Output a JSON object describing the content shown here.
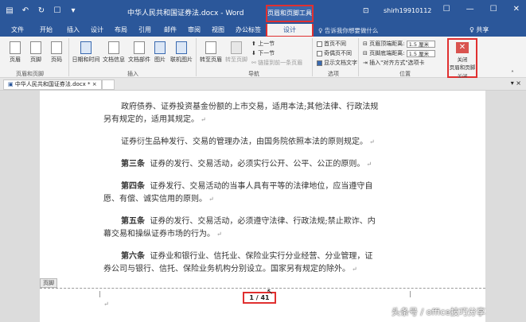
{
  "titlebar": {
    "quick_access": [
      "save-icon",
      "undo-icon",
      "redo-icon",
      "touch-icon",
      "customize-icon"
    ],
    "quick_access_glyphs": [
      "▤",
      "↶",
      "↻",
      "☐",
      "▾"
    ],
    "doc_title": "中华人民共和国证券法.docx - Word",
    "contextual_tool": "页眉和页脚工具",
    "account": "shirh19910112",
    "window_buttons": [
      "☐",
      "—",
      "☐",
      "✕"
    ]
  },
  "tabs": {
    "items": [
      "文件",
      "开始",
      "插入",
      "设计",
      "布局",
      "引用",
      "邮件",
      "审阅",
      "视图",
      "办公标签"
    ],
    "active": "设计",
    "tellme": "♀ 告诉我你想要做什么",
    "share": "♀ 共享"
  },
  "ribbon": {
    "header_footer": {
      "items": [
        "页眉",
        "页脚",
        "页码"
      ],
      "group": "页眉和页脚"
    },
    "insert": {
      "items": [
        "日期和时间",
        "文档信息",
        "文档部件",
        "图片",
        "联机图片"
      ],
      "group": "插入"
    },
    "nav": {
      "goto_header": "转至页眉",
      "goto_footer": "转至页脚",
      "prev": "上一节",
      "next": "下一节",
      "link": "链接到前一条页眉",
      "group": "导航"
    },
    "options": {
      "items": [
        "首页不同",
        "奇偶页不同",
        "显示文档文字"
      ],
      "checked": [
        false,
        false,
        true
      ],
      "group": "选项"
    },
    "position": {
      "header_dist_label": "页眉顶端距离:",
      "header_dist_value": "1.5 厘米",
      "footer_dist_label": "页脚底端距离:",
      "footer_dist_value": "1.5 厘米",
      "insert_align": "插入\"对齐方式\"选项卡",
      "group": "位置"
    },
    "close": {
      "line1": "关闭",
      "line2": "页眉和页脚",
      "group": "关闭"
    }
  },
  "doctabs": {
    "active": "中华人民共和国证券法.docx *",
    "close_glyph": "×",
    "right_glyph": "▾"
  },
  "document": {
    "lines": [
      "政府债券、证券投资基金份额的上市交易，适用本法;其他法律、行政法规",
      "另有规定的，适用其规定。",
      "证券衍生品种发行、交易的管理办法，由国务院依照本法的原则规定。",
      "证券的发行、交易活动，必须实行公开、公平、公正的原则。",
      "证券发行、交易活动的当事人具有平等的法律地位，应当遵守自",
      "愿、有偿、诚实信用的原则。",
      "证券的发行、交易活动，必须遵守法律、行政法规;禁止欺诈、内",
      "幕交易和操纵证券市场的行为。",
      "证券业和银行业、信托业、保险业实行分业经营、分业管理，证",
      "券公司与银行、信托、保险业务机构分别设立。国家另有规定的除外。"
    ],
    "articles": {
      "a3": "第三条",
      "a4": "第四条",
      "a5": "第五条",
      "a6": "第六条"
    },
    "para_mark": "↵",
    "footer_label": "页脚",
    "page_num": "1 / 41"
  },
  "watermark": "头条号 / office技巧分享"
}
